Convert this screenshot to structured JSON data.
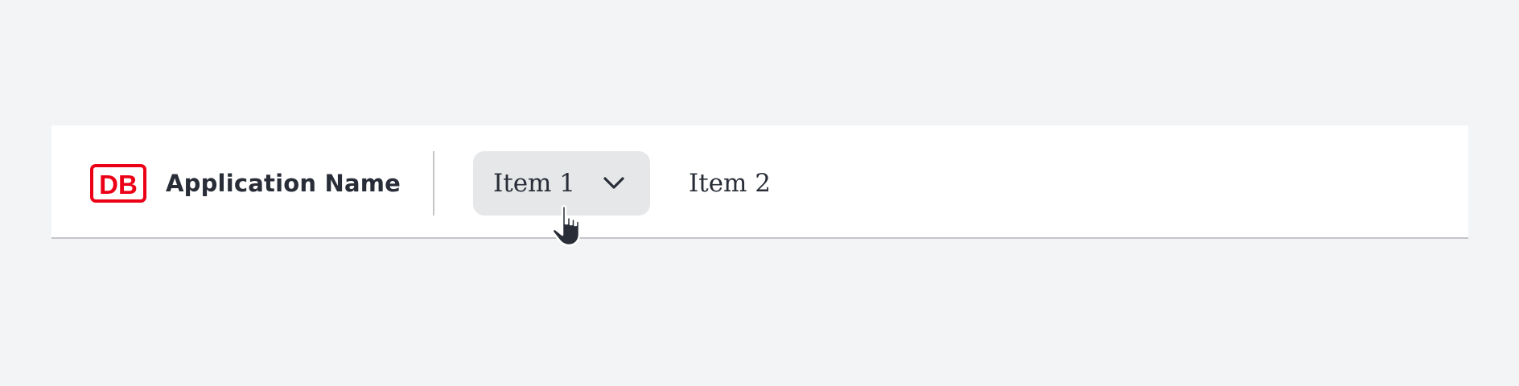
{
  "brand": {
    "logo_text": "DB",
    "app_name": "Application Name",
    "color": "#ec0016"
  },
  "navigation": {
    "items": [
      {
        "label": "Item 1",
        "has_dropdown": true,
        "state": "hover"
      },
      {
        "label": "Item 2",
        "has_dropdown": false,
        "state": "default"
      }
    ]
  },
  "icons": {
    "dropdown": "chevron-down-icon",
    "pointer": "hand-pointer-icon"
  },
  "colors": {
    "background": "#f3f4f6",
    "header": "#ffffff",
    "hover": "#e6e7e9",
    "text": "#282d37",
    "divider": "#c3c5c9"
  }
}
